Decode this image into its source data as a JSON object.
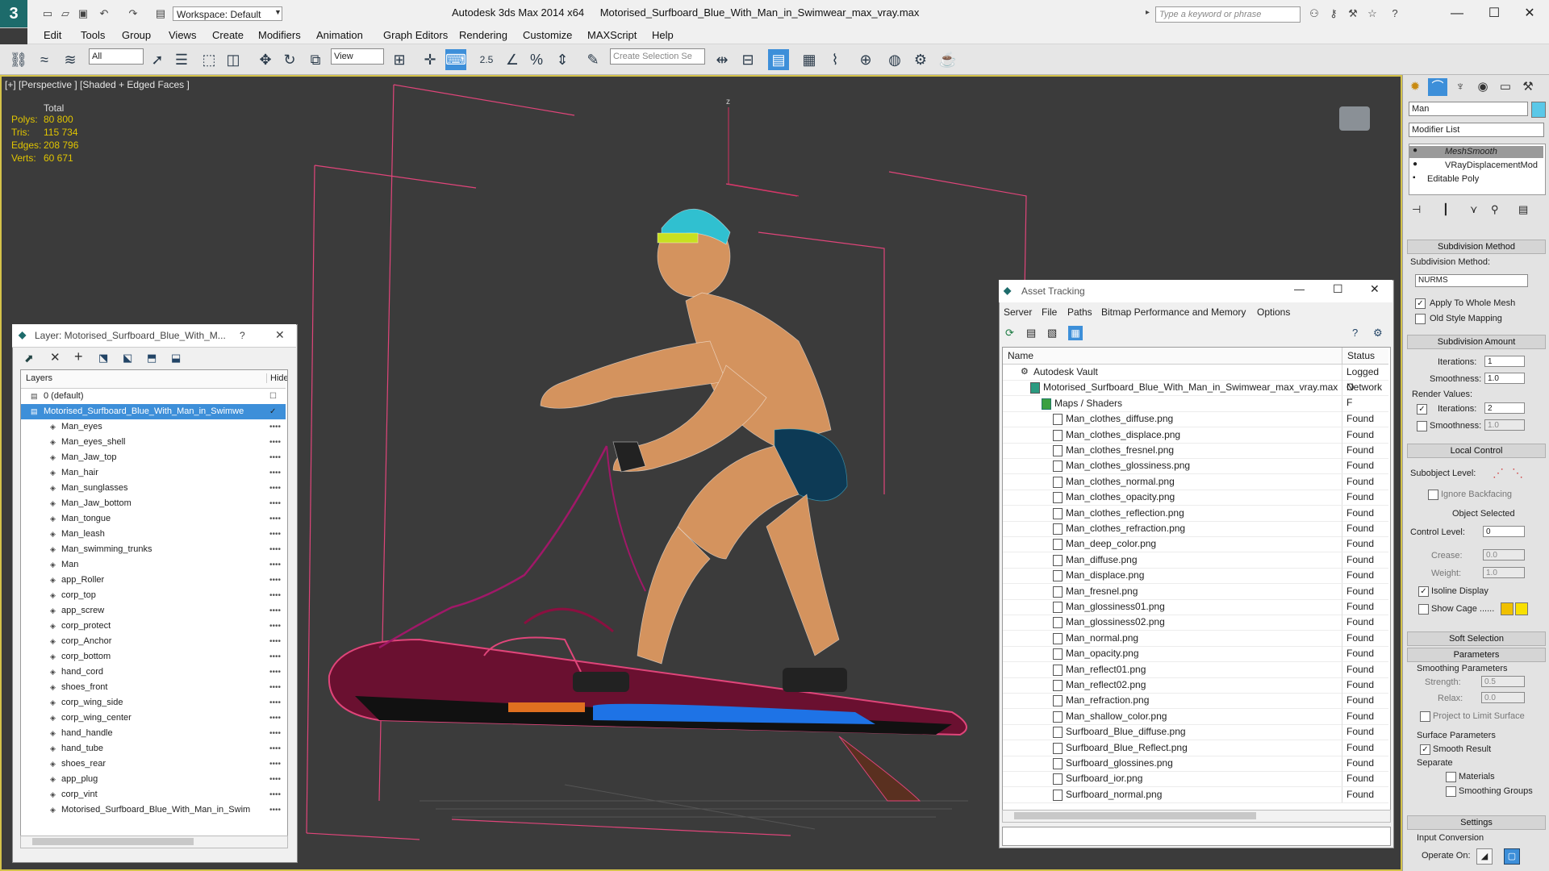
{
  "title_bar": {
    "app_title": "Autodesk 3ds Max  2014 x64",
    "file_title": "Motorised_Surfboard_Blue_With_Man_in_Swimwear_max_vray.max",
    "workspace": "Workspace: Default",
    "search_placeholder": "Type a keyword or phrase"
  },
  "menu": [
    "Edit",
    "Tools",
    "Group",
    "Views",
    "Create",
    "Modifiers",
    "Animation",
    "Graph Editors",
    "Rendering",
    "Customize",
    "MAXScript",
    "Help"
  ],
  "toolbar": {
    "selection_filter": "All",
    "ref_coord": "View",
    "snap_value": "2.5",
    "selection_set_placeholder": "Create Selection Se"
  },
  "viewport": {
    "label": "[+] [Perspective ] [Shaded + Edged Faces ]",
    "stats": {
      "header": "Total",
      "rows": [
        {
          "label": "Polys:",
          "value": "80 800"
        },
        {
          "label": "Tris:",
          "value": "115 734"
        },
        {
          "label": "Edges:",
          "value": "208 796"
        },
        {
          "label": "Verts:",
          "value": "60 671"
        }
      ]
    },
    "axis_label": "z"
  },
  "layer_panel": {
    "title": "Layer: Motorised_Surfboard_Blue_With_M...",
    "help": "?",
    "col_layers": "Layers",
    "col_hide": "Hide",
    "items": [
      {
        "name": "0 (default)",
        "level": 0
      },
      {
        "name": "Motorised_Surfboard_Blue_With_Man_in_Swimwe",
        "level": 0,
        "selected": true
      },
      {
        "name": "Man_eyes",
        "level": 1
      },
      {
        "name": "Man_eyes_shell",
        "level": 1
      },
      {
        "name": "Man_Jaw_top",
        "level": 1
      },
      {
        "name": "Man_hair",
        "level": 1
      },
      {
        "name": "Man_sunglasses",
        "level": 1
      },
      {
        "name": "Man_Jaw_bottom",
        "level": 1
      },
      {
        "name": "Man_tongue",
        "level": 1
      },
      {
        "name": "Man_leash",
        "level": 1
      },
      {
        "name": "Man_swimming_trunks",
        "level": 1
      },
      {
        "name": "Man",
        "level": 1
      },
      {
        "name": "app_Roller",
        "level": 1
      },
      {
        "name": "corp_top",
        "level": 1
      },
      {
        "name": "app_screw",
        "level": 1
      },
      {
        "name": "corp_protect",
        "level": 1
      },
      {
        "name": "corp_Anchor",
        "level": 1
      },
      {
        "name": "corp_bottom",
        "level": 1
      },
      {
        "name": "hand_cord",
        "level": 1
      },
      {
        "name": "shoes_front",
        "level": 1
      },
      {
        "name": "corp_wing_side",
        "level": 1
      },
      {
        "name": "corp_wing_center",
        "level": 1
      },
      {
        "name": "hand_handle",
        "level": 1
      },
      {
        "name": "hand_tube",
        "level": 1
      },
      {
        "name": "shoes_rear",
        "level": 1
      },
      {
        "name": "app_plug",
        "level": 1
      },
      {
        "name": "corp_vint",
        "level": 1
      },
      {
        "name": "Motorised_Surfboard_Blue_With_Man_in_Swim",
        "level": 1
      }
    ]
  },
  "asset_panel": {
    "title": "Asset Tracking",
    "menu": [
      "Server",
      "File",
      "Paths",
      "Bitmap Performance and Memory",
      "Options"
    ],
    "col_name": "Name",
    "col_status": "Status",
    "rows": [
      {
        "name": "Autodesk Vault",
        "status": "Logged O",
        "indent": 1
      },
      {
        "name": "Motorised_Surfboard_Blue_With_Man_in_Swimwear_max_vray.max",
        "status": "Network F",
        "indent": 2
      },
      {
        "name": "Maps / Shaders",
        "status": "",
        "indent": 3
      },
      {
        "name": "Man_clothes_diffuse.png",
        "status": "Found",
        "indent": 4
      },
      {
        "name": "Man_clothes_displace.png",
        "status": "Found",
        "indent": 4
      },
      {
        "name": "Man_clothes_fresnel.png",
        "status": "Found",
        "indent": 4
      },
      {
        "name": "Man_clothes_glossiness.png",
        "status": "Found",
        "indent": 4
      },
      {
        "name": "Man_clothes_normal.png",
        "status": "Found",
        "indent": 4
      },
      {
        "name": "Man_clothes_opacity.png",
        "status": "Found",
        "indent": 4
      },
      {
        "name": "Man_clothes_reflection.png",
        "status": "Found",
        "indent": 4
      },
      {
        "name": "Man_clothes_refraction.png",
        "status": "Found",
        "indent": 4
      },
      {
        "name": "Man_deep_color.png",
        "status": "Found",
        "indent": 4
      },
      {
        "name": "Man_diffuse.png",
        "status": "Found",
        "indent": 4
      },
      {
        "name": "Man_displace.png",
        "status": "Found",
        "indent": 4
      },
      {
        "name": "Man_fresnel.png",
        "status": "Found",
        "indent": 4
      },
      {
        "name": "Man_glossiness01.png",
        "status": "Found",
        "indent": 4
      },
      {
        "name": "Man_glossiness02.png",
        "status": "Found",
        "indent": 4
      },
      {
        "name": "Man_normal.png",
        "status": "Found",
        "indent": 4
      },
      {
        "name": "Man_opacity.png",
        "status": "Found",
        "indent": 4
      },
      {
        "name": "Man_reflect01.png",
        "status": "Found",
        "indent": 4
      },
      {
        "name": "Man_reflect02.png",
        "status": "Found",
        "indent": 4
      },
      {
        "name": "Man_refraction.png",
        "status": "Found",
        "indent": 4
      },
      {
        "name": "Man_shallow_color.png",
        "status": "Found",
        "indent": 4
      },
      {
        "name": "Surfboard_Blue_diffuse.png",
        "status": "Found",
        "indent": 4
      },
      {
        "name": "Surfboard_Blue_Reflect.png",
        "status": "Found",
        "indent": 4
      },
      {
        "name": "Surfboard_glossines.png",
        "status": "Found",
        "indent": 4
      },
      {
        "name": "Surfboard_ior.png",
        "status": "Found",
        "indent": 4
      },
      {
        "name": "Surfboard_normal.png",
        "status": "Found",
        "indent": 4
      }
    ]
  },
  "command_panel": {
    "object_name": "Man",
    "modifier_list": "Modifier List",
    "stack": [
      "MeshSmooth",
      "VRayDisplacementMod",
      "Editable Poly"
    ],
    "subdivision_method_header": "Subdivision Method",
    "subdivision_method_label": "Subdivision Method:",
    "subdivision_method_value": "NURMS",
    "apply_whole_mesh": "Apply To Whole Mesh",
    "old_style_mapping": "Old Style Mapping",
    "subdivision_amount_header": "Subdivision Amount",
    "iterations_label": "Iterations:",
    "iterations_value": "1",
    "smoothness_label": "Smoothness:",
    "smoothness_value": "1.0",
    "render_values_label": "Render Values:",
    "render_iterations_value": "2",
    "render_smoothness_value": "1.0",
    "local_control_header": "Local Control",
    "subobject_level_label": "Subobject Level:",
    "ignore_backfacing": "Ignore Backfacing",
    "object_selected": "Object Selected",
    "control_level_label": "Control Level:",
    "control_level_value": "0",
    "crease_label": "Crease:",
    "crease_value": "0.0",
    "weight_label": "Weight:",
    "weight_value": "1.0",
    "isoline_display": "Isoline Display",
    "show_cage": "Show Cage ......",
    "soft_selection_header": "Soft Selection",
    "parameters_header": "Parameters",
    "smoothing_parameters": "Smoothing Parameters",
    "strength_label": "Strength:",
    "strength_value": "0.5",
    "relax_label": "Relax:",
    "relax_value": "0.0",
    "project_limit": "Project to Limit Surface",
    "surface_parameters": "Surface Parameters",
    "smooth_result": "Smooth Result",
    "separate_label": "Separate",
    "materials": "Materials",
    "smoothing_groups": "Smoothing Groups",
    "settings_header": "Settings",
    "input_conversion": "Input Conversion",
    "operate_on": "Operate On:"
  },
  "colors": {
    "selection_blue": "#3d8fd9",
    "stat_yellow": "#e0c400",
    "viewport_border": "#d4c24a",
    "wire_pink": "#e0457a",
    "skin": "#d4935e",
    "board_blue": "#1e73e6"
  }
}
